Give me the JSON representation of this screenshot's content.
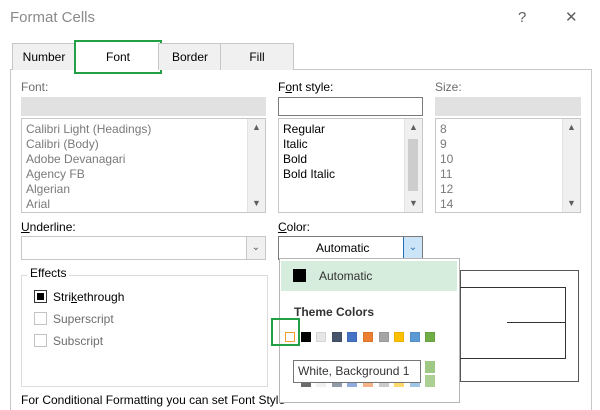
{
  "window": {
    "title": "Format Cells",
    "help": "?",
    "close": "✕"
  },
  "tabs": [
    "Number",
    "Font",
    "Border",
    "Fill"
  ],
  "font": {
    "label": "Font:",
    "value": "",
    "items": [
      "Calibri Light (Headings)",
      "Calibri (Body)",
      "Adobe Devanagari",
      "Agency FB",
      "Algerian",
      "Arial"
    ]
  },
  "font_style": {
    "label_prefix": "F",
    "label_underlined": "o",
    "label_suffix": "nt style:",
    "value": "",
    "items": [
      "Regular",
      "Italic",
      "Bold",
      "Bold Italic"
    ]
  },
  "size": {
    "label": "Size:",
    "value": "",
    "items": [
      "8",
      "9",
      "10",
      "11",
      "12",
      "14"
    ]
  },
  "underline": {
    "label_underlined": "U",
    "label_suffix": "nderline:",
    "value": ""
  },
  "color": {
    "label_underlined": "C",
    "label_suffix": "olor:",
    "value": "Automatic"
  },
  "effects": {
    "title": "Effects",
    "strikethrough": {
      "prefix": "Stri",
      "underlined": "k",
      "suffix": "ethrough",
      "checked": true
    },
    "superscript": "Superscript",
    "subscript": "Subscript"
  },
  "color_dropdown": {
    "automatic": "Automatic",
    "theme_colors_heading": "Theme Colors",
    "theme_colors": [
      "#ffffff",
      "#000000",
      "#e7e6e6",
      "#44546a",
      "#4472c4",
      "#ed7d31",
      "#a5a5a5",
      "#ffc000",
      "#5b9bd5",
      "#70ad47"
    ],
    "tooltip": "White, Background 1"
  },
  "footer": {
    "partial_text": "For Conditional Formatting you can set Font Style"
  },
  "colors": {
    "highlight_green": "#21a045",
    "automatic_bg": "#d6ecdd",
    "accent_blue": "#1f6fb5"
  }
}
